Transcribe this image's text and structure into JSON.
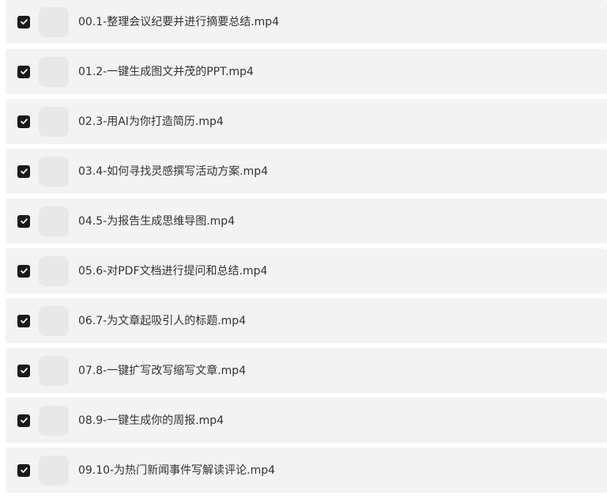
{
  "colors": {
    "row_background": "#f3f3f4",
    "checkbox_fill": "#1a1a1a",
    "thumbnail_placeholder": "#e8e8e9",
    "text": "#333333"
  },
  "files": [
    {
      "name": "00.1-整理会议纪要并进行摘要总结.mp4",
      "checked": true
    },
    {
      "name": "01.2-一键生成图文并茂的PPT.mp4",
      "checked": true
    },
    {
      "name": "02.3-用AI为你打造简历.mp4",
      "checked": true
    },
    {
      "name": "03.4-如何寻找灵感撰写活动方案.mp4",
      "checked": true
    },
    {
      "name": "04.5-为报告生成思维导图.mp4",
      "checked": true
    },
    {
      "name": "05.6-对PDF文档进行提问和总结.mp4",
      "checked": true
    },
    {
      "name": "06.7-为文章起吸引人的标题.mp4",
      "checked": true
    },
    {
      "name": "07.8-一键扩写改写缩写文章.mp4",
      "checked": true
    },
    {
      "name": "08.9-一键生成你的周报.mp4",
      "checked": true
    },
    {
      "name": "09.10-为热门新闻事件写解读评论.mp4",
      "checked": true
    }
  ]
}
